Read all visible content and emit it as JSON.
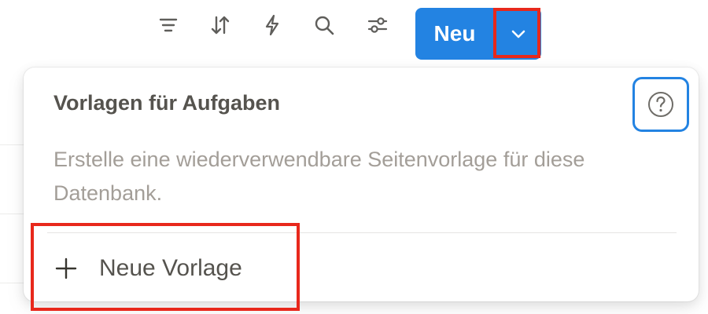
{
  "toolbar": {
    "icons": [
      "filter-icon",
      "sort-icon",
      "automation-icon",
      "search-icon",
      "settings-icon"
    ],
    "new_button": {
      "label": "Neu",
      "arrow_icon": "chevron-down-icon"
    }
  },
  "templates_menu": {
    "title": "Vorlagen für Aufgaben",
    "help_icon": "help-icon",
    "description": "Erstelle eine wiederverwendbare Seitenvorlage für diese Datenbank.",
    "new_template": {
      "icon": "plus-icon",
      "label": "Neue Vorlage"
    }
  },
  "colors": {
    "accent": "#2383e2",
    "highlight": "#e8281c",
    "text": "#55534e",
    "muted_text": "#a39e98"
  }
}
